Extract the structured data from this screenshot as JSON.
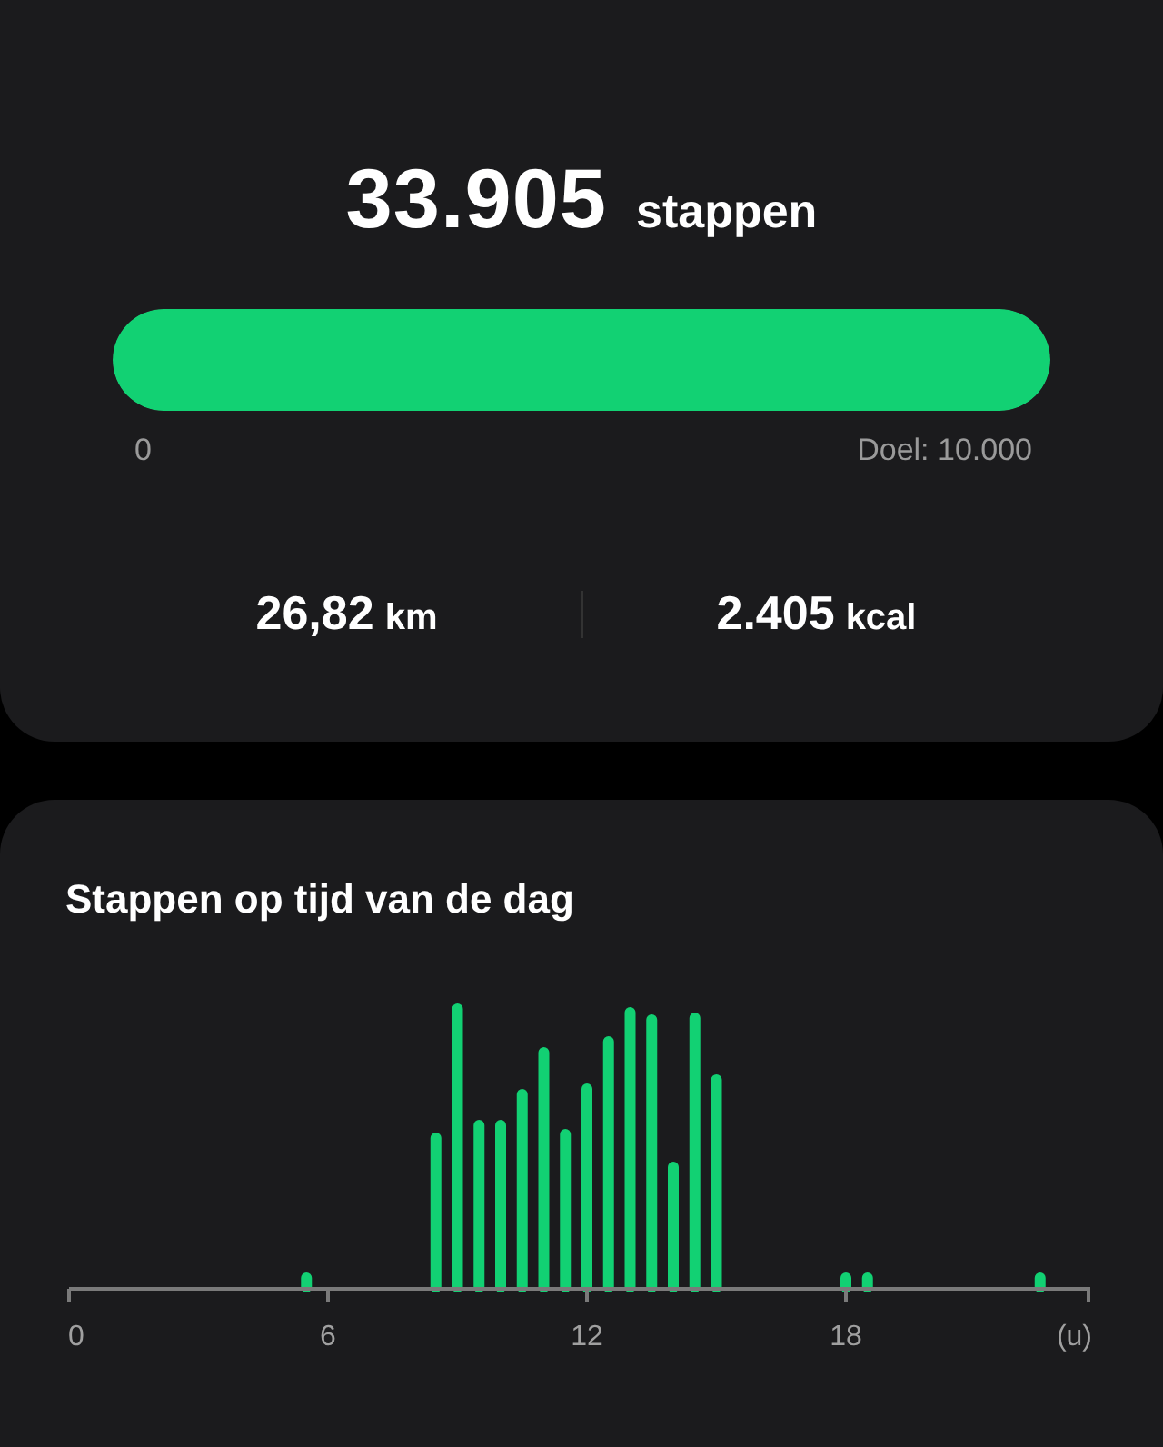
{
  "summary": {
    "steps": "33.905",
    "steps_unit": "stappen",
    "progress": {
      "level": 1,
      "start_label": "0",
      "goal_label": "Doel: 10.000"
    },
    "stats": [
      {
        "value": "26,82",
        "unit": "km"
      },
      {
        "value": "2.405",
        "unit": "kcal"
      }
    ]
  },
  "hourly_chart": {
    "title": "Stappen op tijd van de dag",
    "x_labels": [
      "0",
      "6",
      "12",
      "18"
    ],
    "x_unit": "(u)"
  }
}
